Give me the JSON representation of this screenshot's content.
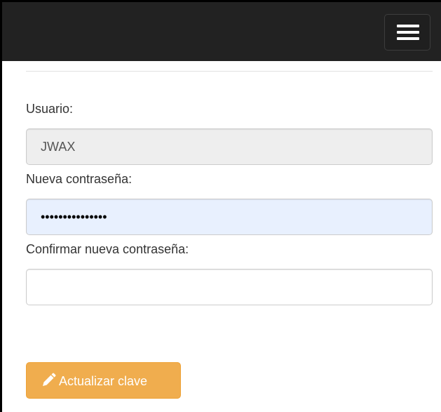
{
  "navbar": {
    "toggle_icon": "hamburger-icon"
  },
  "form": {
    "username_label": "Usuario:",
    "username_value": "JWAX",
    "new_password_label": "Nueva contraseña:",
    "new_password_value": "•••••••••••••••",
    "confirm_password_label": "Confirmar nueva contraseña:",
    "confirm_password_value": "",
    "submit_label": "Actualizar clave",
    "submit_icon": "pencil-icon"
  },
  "colors": {
    "navbar_bg": "#222222",
    "button_warning": "#f0ad4e",
    "readonly_bg": "#eeeeee",
    "autofill_bg": "#e8f0fe"
  }
}
